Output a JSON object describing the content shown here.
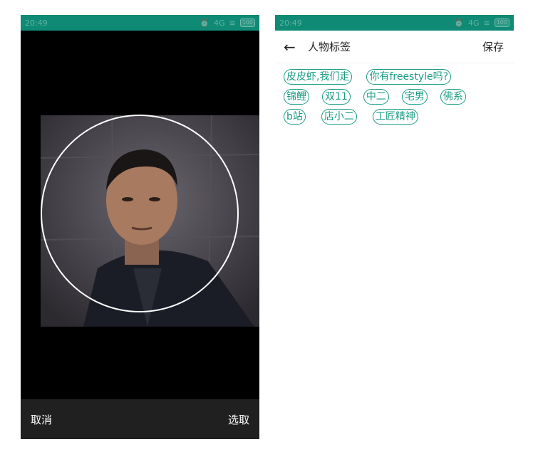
{
  "left": {
    "status_time": "20:49",
    "status_signal": "4G",
    "status_battery": "100",
    "cancel_label": "取消",
    "select_label": "选取"
  },
  "right": {
    "status_time": "20:49",
    "status_signal": "4G",
    "status_battery": "100",
    "back_icon": "←",
    "title": "人物标签",
    "save_label": "保存",
    "tags": [
      [
        "皮皮虾,我们走",
        "你有freestyle吗?"
      ],
      [
        "锦鲤",
        "双11",
        "中二",
        "宅男",
        "佛系"
      ],
      [
        "b站",
        "店小二",
        "工匠精神"
      ]
    ]
  },
  "colors": {
    "accent": "#1a9c84",
    "statusbar": "#0f8a74",
    "crop_toolbar": "#202020"
  }
}
